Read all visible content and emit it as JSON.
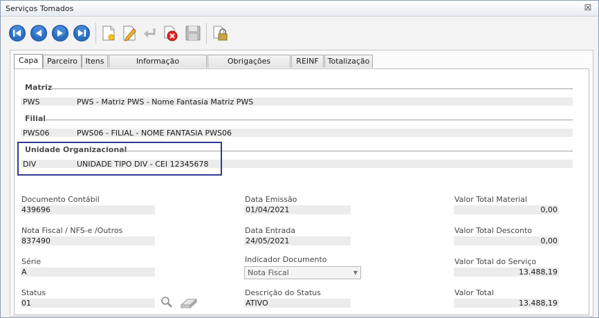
{
  "window": {
    "title": "Serviços Tomados",
    "close_symbol": "☒"
  },
  "toolbar": {
    "buttons": [
      "first-record-icon",
      "previous-record-icon",
      "next-record-icon",
      "last-record-icon",
      "new-icon",
      "edit-icon",
      "undo-icon",
      "delete-icon",
      "save-icon",
      "lock-icon"
    ]
  },
  "tabs": [
    {
      "label": "Capa",
      "active": true
    },
    {
      "label": "Parceiro"
    },
    {
      "label": "Itens"
    },
    {
      "label": "Informação Complementar"
    },
    {
      "label": "Obrigações Municipais"
    },
    {
      "label": "REINF"
    },
    {
      "label": "Totalização"
    }
  ],
  "matriz": {
    "heading": "Matriz",
    "code": "PWS",
    "description": "PWS - Matriz PWS - Nome Fantasia Matriz PWS"
  },
  "filial": {
    "heading": "Filial",
    "code": "PWS06",
    "description": "PWS06 - FILIAL - NOME FANTASIA PWS06"
  },
  "unidade": {
    "heading": "Unidade Organizacional",
    "code": "DIV",
    "description": "UNIDADE TIPO DIV - CEI 12345678"
  },
  "fields": {
    "documento_contabil": {
      "label": "Documento Contábil",
      "value": "439696"
    },
    "nota_fiscal": {
      "label": "Nota Fiscal / NFS-e /Outros",
      "value": "837490"
    },
    "serie": {
      "label": "Série",
      "value": "A"
    },
    "status": {
      "label": "Status",
      "value": "01"
    },
    "data_emissao": {
      "label": "Data Emissão",
      "value": "01/04/2021"
    },
    "data_entrada": {
      "label": "Data Entrada",
      "value": "24/05/2021"
    },
    "indicador_documento": {
      "label": "Indicador Documento",
      "value": "Nota Fiscal"
    },
    "descricao_status": {
      "label": "Descrição do Status",
      "value": "ATIVO"
    },
    "valor_total_material": {
      "label": "Valor Total Material",
      "value": "0,00"
    },
    "valor_total_desconto": {
      "label": "Valor Total Desconto",
      "value": "0,00"
    },
    "valor_total_servico": {
      "label": "Valor Total do Serviço",
      "value": "13.488,19"
    },
    "valor_total": {
      "label": "Valor Total",
      "value": "13.488,19"
    }
  }
}
